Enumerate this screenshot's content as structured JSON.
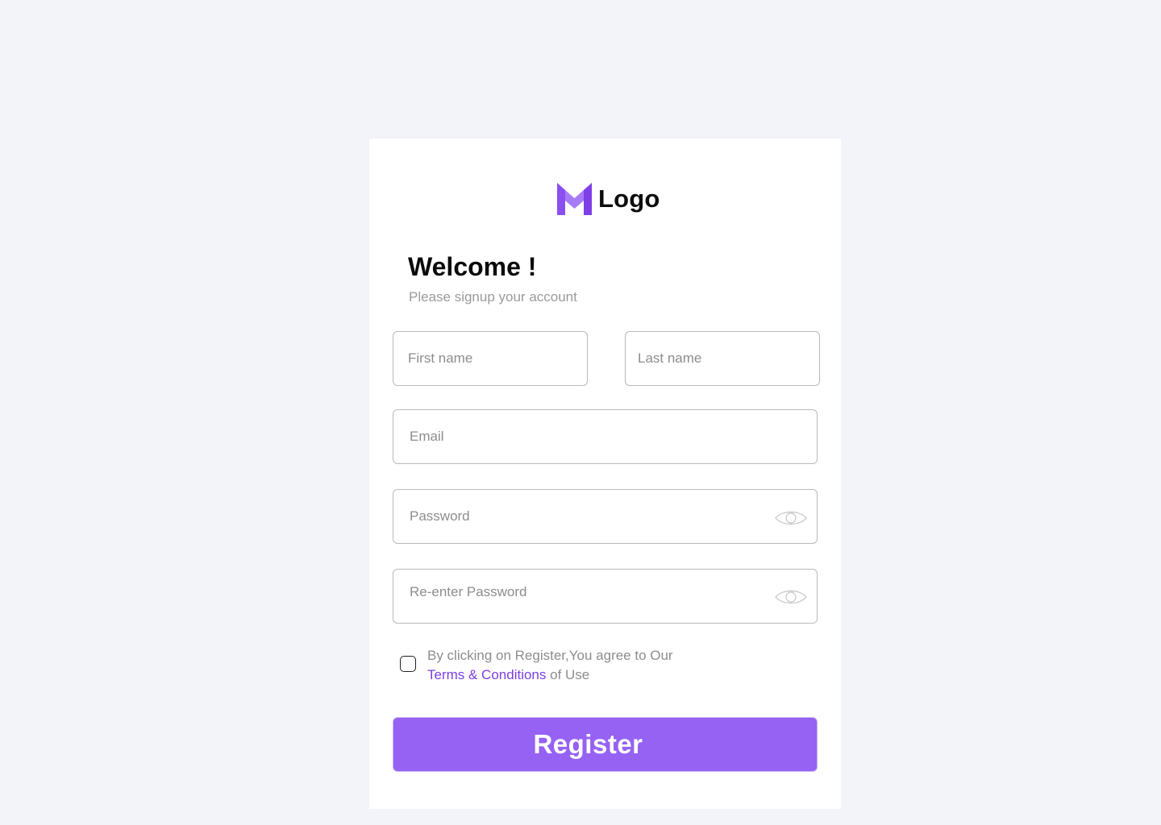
{
  "brand": {
    "name": "Logo",
    "logo_icon": "m-logo-icon",
    "colors": {
      "primary": "#9562f3",
      "logo_light": "#a77bf6",
      "logo_dark": "#7e3fe6",
      "link": "#7b3fe4",
      "background": "#f3f4f9"
    }
  },
  "header": {
    "title": "Welcome !",
    "subtitle": "Please signup your account"
  },
  "form": {
    "first_name": {
      "placeholder": "First name",
      "value": ""
    },
    "last_name": {
      "placeholder": "Last name",
      "value": ""
    },
    "email": {
      "placeholder": "Email",
      "value": ""
    },
    "password": {
      "placeholder": "Password",
      "value": "",
      "toggle_icon": "eye-icon"
    },
    "confirm_password": {
      "placeholder": "Re-enter Password",
      "value": "",
      "toggle_icon": "eye-icon"
    },
    "agreement": {
      "checked": false,
      "line1": "By clicking on Register,You agree to Our",
      "link_text": "Terms & Conditions",
      "suffix": " of Use"
    },
    "submit_label": "Register"
  }
}
